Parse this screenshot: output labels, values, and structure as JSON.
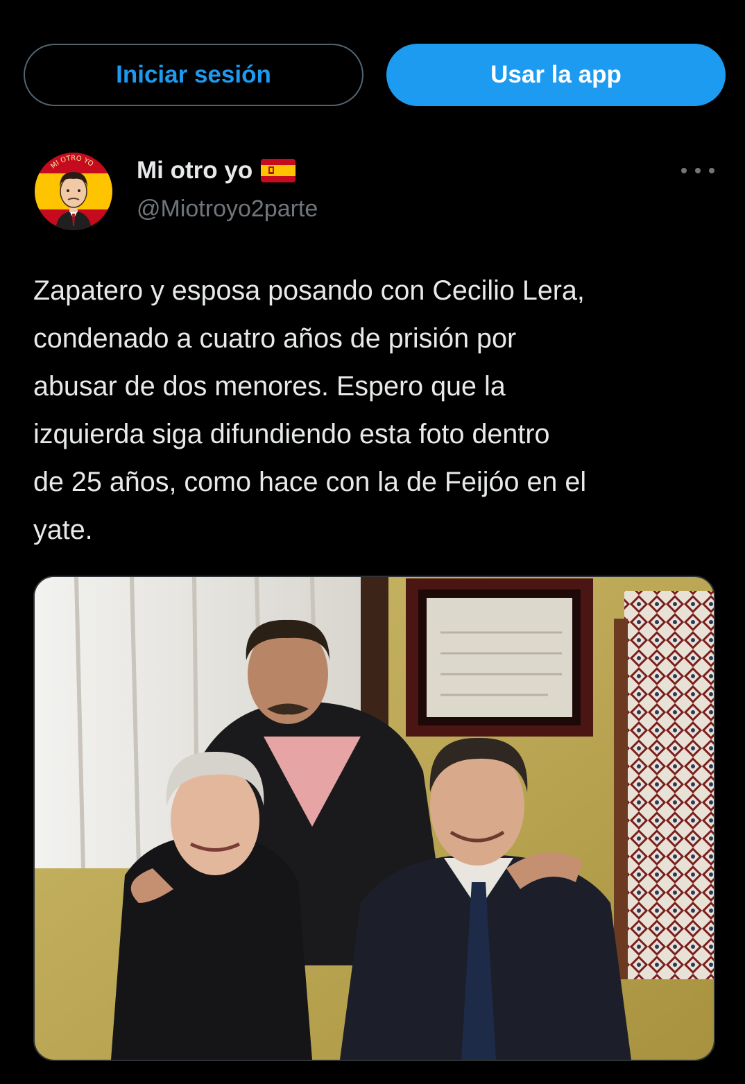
{
  "topbar": {
    "login_label": "Iniciar sesión",
    "app_label": "Usar la app"
  },
  "tweet": {
    "display_name": "Mi otro yo",
    "flag_icon": "spain-flag-emoji",
    "avatar_text": "MI OTRO YO",
    "handle": "@Miotroyo2parte",
    "more_icon": "more-options-icon",
    "text": "Zapatero y esposa posando con Cecilio Lera,\ncondenado a cuatro años de prisión por\nabusar de dos menores. Espero que la\nizquierda siga difundiendo esta foto dentro\nde 25 años, como hace con la de Feijóo en el\nyate."
  },
  "colors": {
    "background": "#000000",
    "accent": "#1d9bf0",
    "text_primary": "#e7e9ea",
    "text_secondary": "#71767b",
    "border": "#536471"
  }
}
